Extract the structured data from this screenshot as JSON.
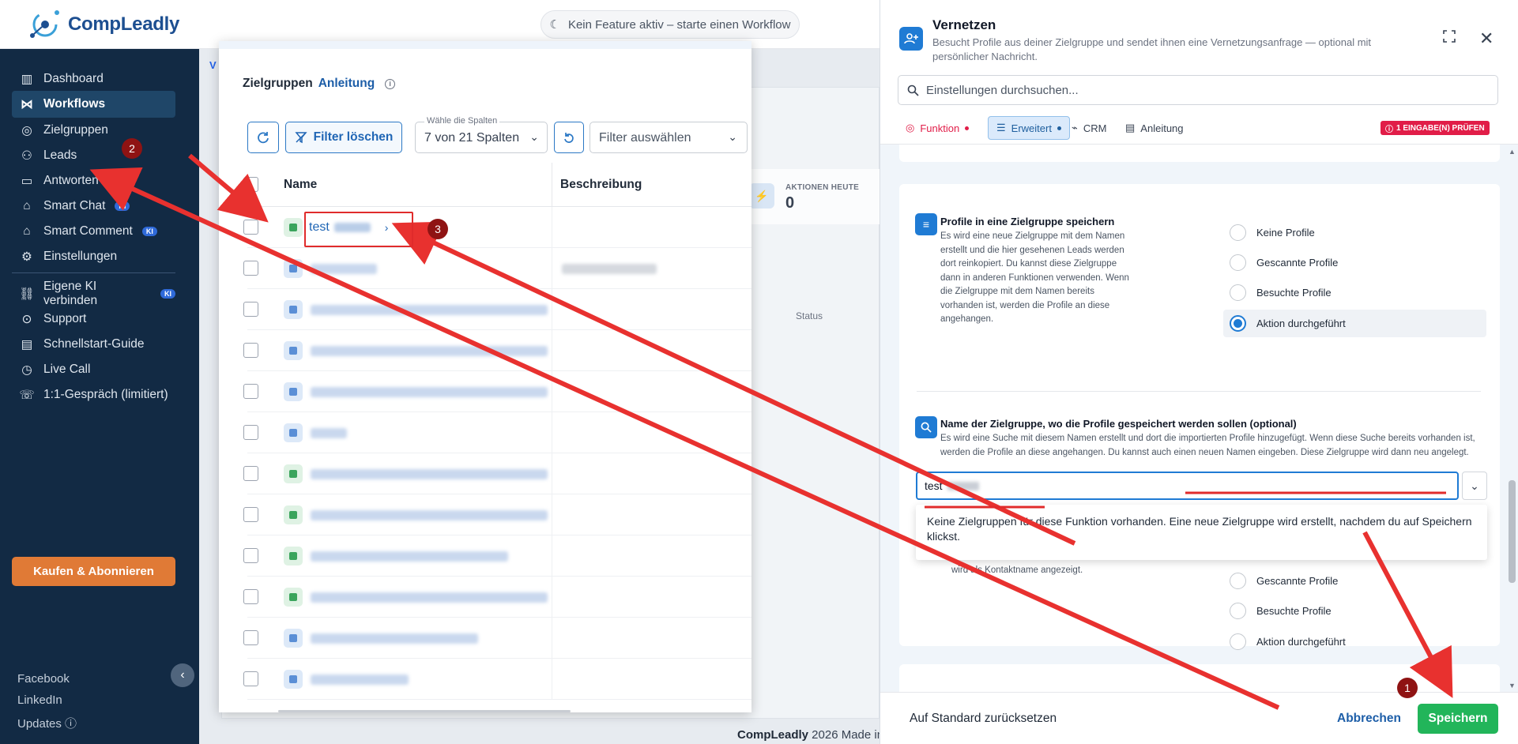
{
  "app": {
    "logo_text": "CompLeadly",
    "feature_pill": "Kein Feature aktiv – starte einen Workflow"
  },
  "sidebar": {
    "items": [
      {
        "label": "Dashboard",
        "icon": "chart-icon"
      },
      {
        "label": "Workflows",
        "icon": "workflow-icon",
        "active": true
      },
      {
        "label": "Zielgruppen",
        "icon": "target-icon"
      },
      {
        "label": "Leads",
        "icon": "users-icon"
      },
      {
        "label": "Antworten",
        "icon": "message-icon"
      },
      {
        "label": "Smart Chat",
        "icon": "robot-icon",
        "badge": "KI"
      },
      {
        "label": "Smart Comment",
        "icon": "robot-icon",
        "badge": "KI"
      },
      {
        "label": "Einstellungen",
        "icon": "gear-icon"
      },
      {
        "label": "Eigene KI verbinden",
        "icon": "link-icon",
        "badge": "KI"
      },
      {
        "label": "Support",
        "icon": "help-icon"
      },
      {
        "label": "Schnellstart-Guide",
        "icon": "document-icon"
      },
      {
        "label": "Live Call",
        "icon": "clock-icon"
      },
      {
        "label": "1:1-Gespräch (limitiert)",
        "icon": "phone-icon"
      }
    ],
    "buy_button": "Kaufen & Abonnieren",
    "footer_links": [
      "Facebook",
      "LinkedIn",
      "Updates"
    ]
  },
  "background": {
    "stat_label": "AKTIONEN HEUTE",
    "stat_value": "0",
    "status_col": "Status",
    "footer_brand": "CompLeadly",
    "footer_rest": " 2026 Made in"
  },
  "zielgruppen": {
    "title": "Zielgruppen",
    "guide_link": "Anleitung",
    "clear_filter": "Filter löschen",
    "columns_label": "Wähle die Spalten",
    "columns_value": "7 von 21 Spalten",
    "filter_placeholder": "Filter auswählen",
    "header_name": "Name",
    "header_desc": "Beschreibung",
    "first_row_name": "test",
    "rows": [
      {
        "ico": "green",
        "w": 0,
        "d": 0
      },
      {
        "ico": "blue",
        "w": 84,
        "d": 120
      },
      {
        "ico": "blue",
        "w": 300,
        "d": 0
      },
      {
        "ico": "blue",
        "w": 300,
        "d": 0
      },
      {
        "ico": "blue",
        "w": 300,
        "d": 0
      },
      {
        "ico": "blue",
        "w": 46,
        "d": 0
      },
      {
        "ico": "green",
        "w": 300,
        "d": 0
      },
      {
        "ico": "green",
        "w": 300,
        "d": 0
      },
      {
        "ico": "green",
        "w": 250,
        "d": 0
      },
      {
        "ico": "green",
        "w": 300,
        "d": 0
      },
      {
        "ico": "blue",
        "w": 212,
        "d": 0
      },
      {
        "ico": "blue",
        "w": 124,
        "d": 0
      }
    ]
  },
  "vernetzen": {
    "title": "Vernetzen",
    "description": "Besucht Profile aus deiner Zielgruppe und sendet ihnen eine Vernetzungsanfrage — optional mit persönlicher Nachricht.",
    "search_placeholder": "Einstellungen durchsuchen...",
    "tabs": [
      "Funktion",
      "Erweitert",
      "CRM",
      "Anleitung"
    ],
    "error_badge": "1 EINGABE(N) PRÜFEN",
    "section1": {
      "title": "Profile in eine Zielgruppe speichern",
      "desc": "Es wird eine neue Zielgruppe mit dem Namen erstellt und die hier gesehenen Leads werden dort reinkopiert. Du kannst diese Zielgruppe dann in anderen Funktionen verwenden. Wenn die Zielgruppe mit dem Namen bereits vorhanden ist, werden die Profile an diese angehangen.",
      "options": [
        "Keine Profile",
        "Gescannte Profile",
        "Besuchte Profile",
        "Aktion durchgeführt"
      ],
      "selected": 3
    },
    "section2": {
      "title": "Name der Zielgruppe, wo die Profile gespeichert werden sollen (optional)",
      "desc": "Es wird eine Suche mit diesem Namen erstellt und dort die importierten Profile hinzugefügt. Wenn diese Suche bereits vorhanden ist, werden die Profile an diese angehangen. Du kannst auch einen neuen Namen eingeben. Diese Zielgruppe wird dann neu angelegt.",
      "input_value": "test",
      "dropdown_text_a": "Keine Zielgruppen für diese Funktion vorhanden. ",
      "dropdown_text_b": "Eine neue Zielgruppe wird erstellt, nachdem du auf Speichern klickst.",
      "under_text": "wird als Kontaktname angezeigt.",
      "options": [
        "Gescannte Profile",
        "Besuchte Profile",
        "Aktion durchgeführt"
      ]
    },
    "footer": {
      "reset": "Auf Standard zurücksetzen",
      "cancel": "Abbrechen",
      "save": "Speichern"
    }
  },
  "annotations": {
    "badges": [
      "1",
      "2",
      "3"
    ],
    "colors": {
      "arrow": "#e8312f",
      "badge": "#8f1313"
    }
  }
}
